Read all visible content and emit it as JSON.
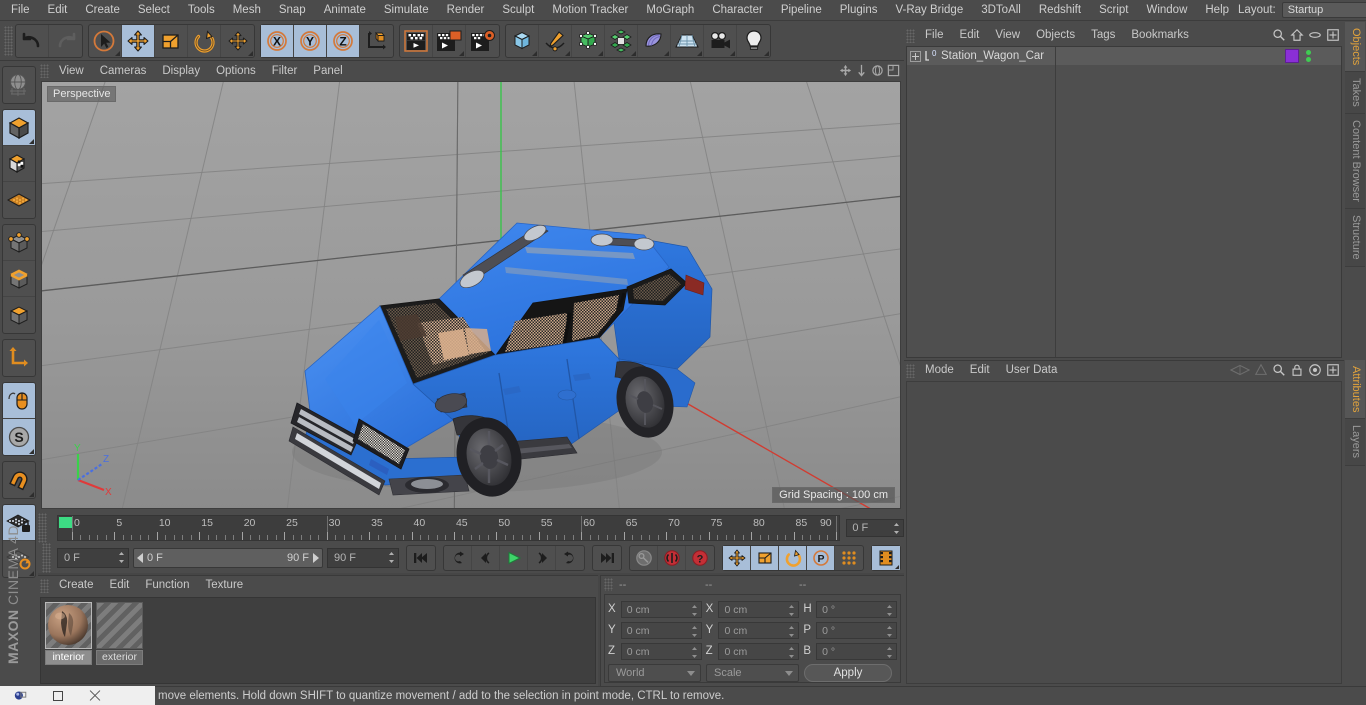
{
  "app": {
    "brand_bold": "MAXON",
    "brand_thin": "CINEMA 4D"
  },
  "menubar": {
    "items": [
      {
        "label": "File"
      },
      {
        "label": "Edit"
      },
      {
        "label": "Create"
      },
      {
        "label": "Select"
      },
      {
        "label": "Tools"
      },
      {
        "label": "Mesh"
      },
      {
        "label": "Snap"
      },
      {
        "label": "Animate"
      },
      {
        "label": "Simulate"
      },
      {
        "label": "Render"
      },
      {
        "label": "Sculpt"
      },
      {
        "label": "Motion Tracker"
      },
      {
        "label": "MoGraph"
      },
      {
        "label": "Character"
      },
      {
        "label": "Pipeline"
      },
      {
        "label": "Plugins"
      },
      {
        "label": "V-Ray Bridge"
      },
      {
        "label": "3DToAll"
      },
      {
        "label": "Redshift"
      },
      {
        "label": "Script"
      },
      {
        "label": "Window"
      },
      {
        "label": "Help"
      }
    ],
    "layout_label": "Layout:",
    "layout_value": "Startup",
    "icons": [
      "search-icon",
      "home-icon",
      "minimize-icon",
      "maximize-icon"
    ]
  },
  "toolbar": {
    "groups": [
      {
        "name": "history",
        "buttons": [
          {
            "name": "undo-button",
            "icon": "undo-icon",
            "selected": false,
            "corner": false
          },
          {
            "name": "redo-button",
            "icon": "redo-icon",
            "selected": false,
            "corner": false
          }
        ]
      },
      {
        "name": "transform-tools",
        "buttons": [
          {
            "name": "live-selection-tool",
            "icon": "cursor-circle-icon",
            "selected": false,
            "corner": true
          },
          {
            "name": "move-tool",
            "icon": "move-arrows-icon",
            "selected": true,
            "corner": false
          },
          {
            "name": "scale-tool",
            "icon": "scale-box-icon",
            "selected": false,
            "corner": false
          },
          {
            "name": "rotate-tool",
            "icon": "rotate-arc-icon",
            "selected": false,
            "corner": false
          },
          {
            "name": "dynamic-place-tool",
            "icon": "move-arrows-icon",
            "selected": false,
            "corner": true
          }
        ]
      },
      {
        "name": "axis-locks",
        "buttons": [
          {
            "name": "lock-x-axis",
            "icon": "x-axis-icon",
            "selected": true,
            "corner": false
          },
          {
            "name": "lock-y-axis",
            "icon": "y-axis-icon",
            "selected": true,
            "corner": false
          },
          {
            "name": "lock-z-axis",
            "icon": "z-axis-icon",
            "selected": true,
            "corner": false
          },
          {
            "name": "world-object-axis",
            "icon": "world-axis-cube-icon",
            "selected": false,
            "corner": false
          }
        ]
      },
      {
        "name": "render-tools",
        "buttons": [
          {
            "name": "render-view-button",
            "icon": "render-view-icon",
            "selected": false,
            "corner": false
          },
          {
            "name": "render-region-button",
            "icon": "render-region-icon",
            "selected": false,
            "corner": true
          },
          {
            "name": "render-settings-button",
            "icon": "render-settings-icon",
            "selected": false,
            "corner": false
          }
        ]
      },
      {
        "name": "create-objects",
        "buttons": [
          {
            "name": "add-cube-button",
            "icon": "cube-icon",
            "selected": false,
            "corner": true
          },
          {
            "name": "add-spline-button",
            "icon": "pen-spline-icon",
            "selected": false,
            "corner": true
          },
          {
            "name": "add-generator-button",
            "icon": "nurbs-cube-icon",
            "selected": false,
            "corner": true
          },
          {
            "name": "add-mograph-button",
            "icon": "mograph-cluster-icon",
            "selected": false,
            "corner": true
          },
          {
            "name": "add-deformer-button",
            "icon": "bend-deformer-icon",
            "selected": false,
            "corner": true
          },
          {
            "name": "add-scene-button",
            "icon": "floor-scene-icon",
            "selected": false,
            "corner": true
          },
          {
            "name": "add-camera-button",
            "icon": "camera-icon",
            "selected": false,
            "corner": true
          },
          {
            "name": "add-light-button",
            "icon": "light-bulb-icon",
            "selected": false,
            "corner": true
          }
        ]
      }
    ]
  },
  "left_rail": {
    "groups": [
      {
        "name": "undo-view-group",
        "buttons": [
          {
            "name": "make-editable-globe",
            "icon": "globe-wire-icon",
            "selected": false,
            "corner": false
          }
        ]
      },
      {
        "name": "mode-group",
        "buttons": [
          {
            "name": "model-mode-button",
            "icon": "model-cube-icon",
            "selected": true,
            "corner": true
          },
          {
            "name": "texture-mode-button",
            "icon": "texture-cube-icon",
            "selected": false,
            "corner": false
          },
          {
            "name": "workplane-mode-button",
            "icon": "workplane-grid-icon",
            "selected": false,
            "corner": false
          }
        ]
      },
      {
        "name": "component-group",
        "buttons": [
          {
            "name": "point-mode-button",
            "icon": "point-mode-icon",
            "selected": false,
            "corner": false
          },
          {
            "name": "edge-mode-button",
            "icon": "edge-mode-icon",
            "selected": false,
            "corner": false
          },
          {
            "name": "polygon-mode-button",
            "icon": "polygon-mode-icon",
            "selected": false,
            "corner": false
          }
        ]
      },
      {
        "name": "axis-group",
        "buttons": [
          {
            "name": "enable-axis-button",
            "icon": "axis-l-icon",
            "selected": false,
            "corner": false
          }
        ]
      },
      {
        "name": "viewport-group",
        "buttons": [
          {
            "name": "viewport-solo-button",
            "icon": "mouse-icon",
            "selected": true,
            "corner": false
          },
          {
            "name": "soft-selection-button",
            "icon": "s-circle-icon",
            "selected": true,
            "corner": true
          }
        ]
      },
      {
        "name": "snap-group",
        "buttons": [
          {
            "name": "enable-snap-button",
            "icon": "magnet-icon",
            "selected": false,
            "corner": true
          }
        ]
      },
      {
        "name": "workplane-group",
        "buttons": [
          {
            "name": "lock-workplane-button",
            "icon": "workplane-lock-icon",
            "selected": true,
            "corner": false
          },
          {
            "name": "planar-workplane-button",
            "icon": "workplane-rotate-icon",
            "selected": false,
            "corner": true
          }
        ]
      }
    ]
  },
  "viewport": {
    "menu": [
      {
        "label": "View"
      },
      {
        "label": "Cameras"
      },
      {
        "label": "Display"
      },
      {
        "label": "Options"
      },
      {
        "label": "Filter"
      },
      {
        "label": "Panel"
      }
    ],
    "nav_icons": [
      "pan-icon",
      "dolly-icon",
      "rotate-view-icon",
      "maximize-view-icon"
    ],
    "perspective_label": "Perspective",
    "grid_spacing_label": "Grid Spacing : 100 cm",
    "axis_gizmo": {
      "x_label": "X",
      "y_label": "Y",
      "z_label": "Z",
      "x_color": "#e03a3a",
      "y_color": "#3ad14a",
      "z_color": "#4a6fe0"
    },
    "scene": {
      "object_name": "Station_Wagon_Car",
      "body_color": "#2f78e0",
      "body_shadow_color": "#2260bd",
      "trim_color": "#3b3b3f",
      "interior_color": "#e0b795",
      "background_top": "#a0a0a0",
      "background_bottom": "#8e8e8e"
    }
  },
  "timeline": {
    "ticks": [
      0,
      5,
      10,
      15,
      20,
      25,
      30,
      35,
      40,
      45,
      50,
      55,
      60,
      65,
      70,
      75,
      80,
      85,
      90
    ],
    "min_frame": 0,
    "max_frame": 90,
    "current_frame_field": "0 F"
  },
  "powerslider": {
    "current_frame": "0 F",
    "range_start": "0 F",
    "range_end": "90 F",
    "end_frame": "90 F",
    "transport": [
      {
        "name": "go-to-start-button",
        "icon": "skip-start-icon"
      },
      {
        "name": "go-to-previous-key-button",
        "icon": "prev-key-icon"
      },
      {
        "name": "step-back-button",
        "icon": "step-back-icon"
      },
      {
        "name": "play-button",
        "icon": "play-icon"
      },
      {
        "name": "step-forward-button",
        "icon": "step-forward-icon"
      },
      {
        "name": "go-to-next-key-button",
        "icon": "next-key-icon"
      },
      {
        "name": "go-to-end-button",
        "icon": "skip-end-icon"
      }
    ],
    "keying": [
      {
        "name": "record-active-objects-button",
        "icon": "key-icon",
        "selected": false
      },
      {
        "name": "autokeying-button",
        "icon": "autokey-circle-icon",
        "selected": false
      },
      {
        "name": "keyframe-selection-button",
        "icon": "question-circle-icon",
        "selected": false
      }
    ],
    "key_filters": [
      {
        "name": "position-key-button",
        "icon": "move-arrows-icon",
        "selected": true
      },
      {
        "name": "scale-key-button",
        "icon": "scale-box-icon",
        "selected": true
      },
      {
        "name": "rotation-key-button",
        "icon": "rotate-arc-icon",
        "selected": true
      },
      {
        "name": "parameter-key-button",
        "icon": "p-circle-icon",
        "selected": true
      },
      {
        "name": "point-level-animation-button",
        "icon": "dots-grid-icon",
        "selected": false
      }
    ],
    "timeline_toggle": {
      "name": "timeline-toggle-button",
      "icon": "film-strip-icon",
      "selected": true
    }
  },
  "material_manager": {
    "menu": [
      {
        "label": "Create"
      },
      {
        "label": "Edit"
      },
      {
        "label": "Function"
      },
      {
        "label": "Texture"
      }
    ],
    "materials": [
      {
        "name": "interior",
        "selected": true,
        "swatch": "textured-sphere"
      },
      {
        "name": "exterior",
        "selected": false,
        "swatch": "diagonal-stripes"
      }
    ]
  },
  "coordinates": {
    "header": [
      "--",
      "--",
      "--"
    ],
    "rows": [
      {
        "pos_label": "X",
        "pos_value": "0 cm",
        "size_label": "X",
        "size_value": "0 cm",
        "rot_label": "H",
        "rot_value": "0 °"
      },
      {
        "pos_label": "Y",
        "pos_value": "0 cm",
        "size_label": "Y",
        "size_value": "0 cm",
        "rot_label": "P",
        "rot_value": "0 °"
      },
      {
        "pos_label": "Z",
        "pos_value": "0 cm",
        "size_label": "Z",
        "size_value": "0 cm",
        "rot_label": "B",
        "rot_value": "0 °"
      }
    ],
    "system_dropdown": "World",
    "mode_dropdown": "Scale",
    "apply_button": "Apply"
  },
  "object_manager": {
    "menu": [
      {
        "label": "File"
      },
      {
        "label": "Edit"
      },
      {
        "label": "View"
      },
      {
        "label": "Objects"
      },
      {
        "label": "Tags"
      },
      {
        "label": "Bookmarks"
      }
    ],
    "tools": [
      "search-icon",
      "home-icon",
      "ellipse-icon",
      "new-window-icon"
    ],
    "rows": [
      {
        "name": "Station_Wagon_Car",
        "selected": true,
        "expandable": true,
        "tag_color": "#8a2fd6",
        "dot_color": "#3fcc52"
      }
    ]
  },
  "attribute_manager": {
    "menu": [
      {
        "label": "Mode"
      },
      {
        "label": "Edit"
      },
      {
        "label": "User Data"
      }
    ],
    "tools": [
      "ruler-icon",
      "cone-icon",
      "search-icon",
      "lock-icon",
      "target-icon",
      "new-window-icon"
    ]
  },
  "right_tabs_top": [
    {
      "label": "Objects",
      "active": true
    },
    {
      "label": "Takes",
      "active": false
    },
    {
      "label": "Content Browser",
      "active": false
    },
    {
      "label": "Structure",
      "active": false
    }
  ],
  "right_tabs_bottom": [
    {
      "label": "Attributes",
      "active": true
    },
    {
      "label": "Layers",
      "active": false
    }
  ],
  "statusbar": {
    "message": "move elements. Hold down SHIFT to quantize movement / add to the selection in point mode, CTRL to remove."
  },
  "window_controls": [
    {
      "name": "app-orb-icon"
    },
    {
      "name": "minimize-window-button"
    },
    {
      "name": "close-window-button"
    }
  ]
}
